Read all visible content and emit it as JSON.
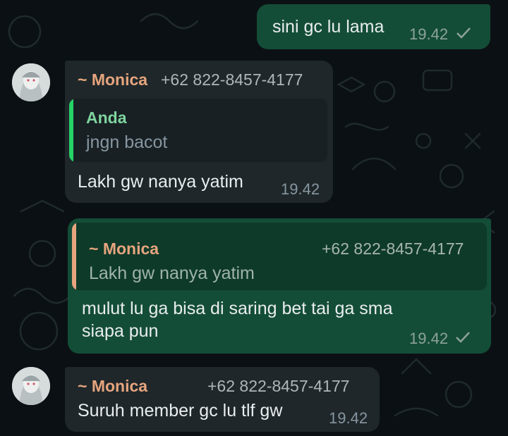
{
  "colors": {
    "background": "#0b1014",
    "outgoing_bubble": "#144d37",
    "incoming_bubble": "#1f272a",
    "quote_in_outgoing": "#0e3a29",
    "quote_in_incoming": "#182024",
    "sender_name": "#e6a57e",
    "quote_self_accent": "#25d366",
    "quote_self_name": "#7fd49f",
    "quote_other_accent": "#e6a57e"
  },
  "messages": [
    {
      "direction": "outgoing",
      "text": "sini gc lu lama",
      "time": "19.42",
      "status_icon": "check-icon"
    },
    {
      "direction": "incoming",
      "sender": "~ Monica",
      "phone": "+62 822-8457-4177",
      "quote": {
        "sender": "Anda",
        "text": "jngn bacot"
      },
      "text": "Lakh gw nanya yatim",
      "time": "19.42"
    },
    {
      "direction": "outgoing",
      "quote": {
        "sender": "~ Monica",
        "phone": "+62 822-8457-4177",
        "text": "Lakh gw nanya yatim"
      },
      "text_line1": "mulut lu ga bisa di saring bet tai ga sma",
      "text_line2": "siapa pun",
      "time": "19.42",
      "status_icon": "check-icon"
    },
    {
      "direction": "incoming",
      "sender": "~ Monica",
      "phone": "+62 822-8457-4177",
      "text": "Suruh member gc lu tlf gw",
      "time": "19.42"
    }
  ]
}
